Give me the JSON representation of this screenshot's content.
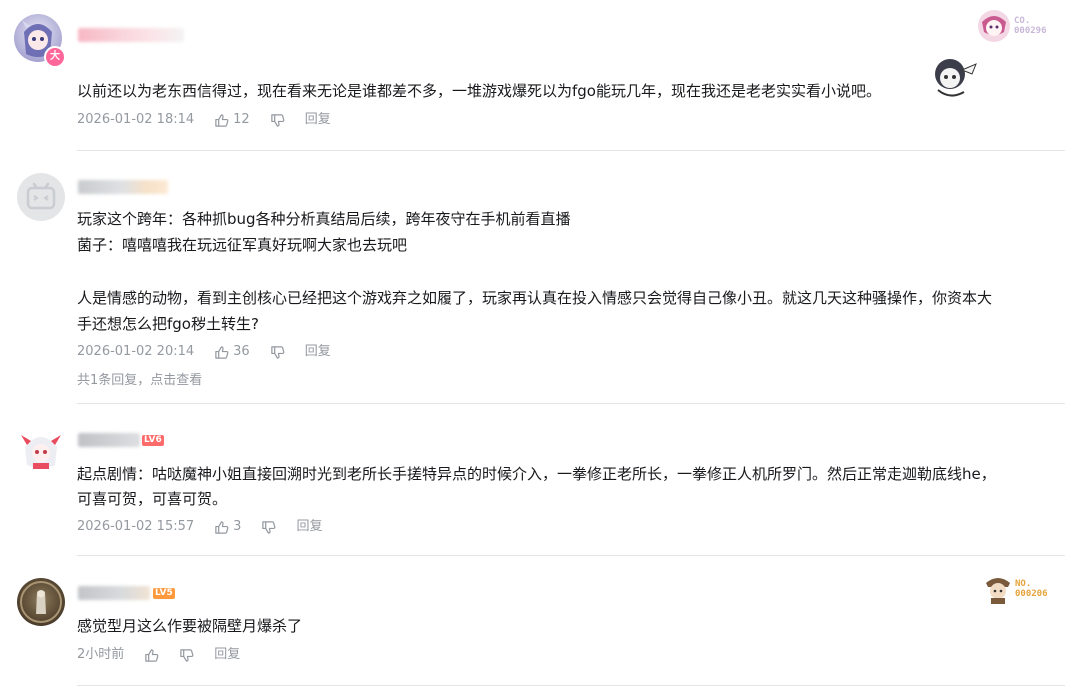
{
  "comments": [
    {
      "text": "以前还以为老东西信得过，现在看来无论是谁都差不多，一堆游戏爆死以为fgo能玩几年，现在我还是老老实实看小说吧。",
      "time": "2026-01-02 18:14",
      "likes": "12",
      "reply_label": "回复",
      "badge_no": "CO.\n000296",
      "badge_color": "#c9b8d8"
    },
    {
      "text_lines": [
        "玩家这个跨年：各种抓bug各种分析真结局后续，跨年夜守在手机前看直播",
        "菌子：嘻嘻嘻我在玩远征军真好玩啊大家也去玩吧",
        "",
        "人是情感的动物，看到主创核心已经把这个游戏弃之如履了，玩家再认真在投入情感只会觉得自己像小丑。就这几天这种骚操作，你资本大",
        "手还想怎么把fgo秽土转生?"
      ],
      "time": "2026-01-02 20:14",
      "likes": "36",
      "reply_label": "回复",
      "sub_replies": "共1条回复，点击查看"
    },
    {
      "level": "LV6",
      "text_lines": [
        "起点剧情：咕哒魔神小姐直接回溯时光到老所长手搓特异点的时候介入，一拳修正老所长，一拳修正人机所罗门。然后正常走迦勒底线he，",
        "可喜可贺，可喜可贺。"
      ],
      "time": "2026-01-02 15:57",
      "likes": "3",
      "reply_label": "回复"
    },
    {
      "level": "LV5",
      "text": "感觉型月这么作要被隔壁月爆杀了",
      "time": "2小时前",
      "likes": "",
      "reply_label": "回复",
      "badge_no": "NO.\n000206",
      "badge_color": "#e5a33a"
    }
  ],
  "colors": {
    "text": "#18191c",
    "meta": "#9499a0",
    "divider": "#e3e5e7",
    "lv6": "#ff6a6a",
    "lv5": "#ff9a3c"
  }
}
